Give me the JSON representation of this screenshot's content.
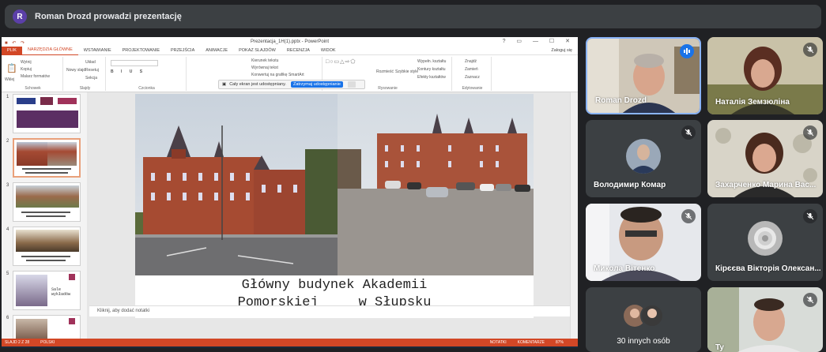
{
  "meeting": {
    "presenter_initial": "R",
    "presenter_banner": "Roman Drozd prowadzi prezentację"
  },
  "ppt": {
    "window_title": "Prezentacja_1H(1).pptx - PowerPoint",
    "tabs": [
      "PLIK",
      "NARZĘDZIA GŁÓWNE",
      "WSTAWIANIE",
      "PROJEKTOWANIE",
      "PRZEJŚCIA",
      "ANIMACJE",
      "POKAZ SLAJDÓW",
      "RECENZJA",
      "WIDOK"
    ],
    "signin": "Zaloguj się",
    "groups": {
      "clipboard": {
        "label": "Schowek",
        "items": [
          "Wklej",
          "Wytnij",
          "Kopiuj",
          "Malarz formatów"
        ]
      },
      "slides": {
        "label": "Slajdy",
        "items": [
          "Nowy slajd",
          "Układ",
          "Resetuj",
          "Sekcja"
        ]
      },
      "font": {
        "label": "Czcionka"
      },
      "paragraph": {
        "items": [
          "Kierunek tekstu",
          "Wyrównaj tekst",
          "Konwertuj na grafikę SmartArt"
        ]
      },
      "drawing": {
        "label": "Rysowanie",
        "items": [
          "Rozmieść",
          "Szybkie style",
          "Wypełn. kształtu",
          "Kontury kształtu",
          "Efekty kształtów"
        ]
      },
      "editing": {
        "label": "Edytowanie",
        "items": [
          "Znajdź",
          "Zamień",
          "Zaznacz"
        ]
      }
    },
    "share_bar": {
      "text": "Cały ekran jest udostępniany.",
      "stop": "Zatrzymaj udostępnianie"
    },
    "thumbnails": [
      {
        "num": "1"
      },
      {
        "num": "2"
      },
      {
        "num": "3"
      },
      {
        "num": "4"
      },
      {
        "num": "5",
        "caption": "Sale wykładów"
      },
      {
        "num": "6"
      }
    ],
    "slide_caption_line1": "Główny budynek Akademii",
    "slide_caption_line2": "Pomorskiej     w Słupsku",
    "notes_placeholder": "Kliknij, aby dodać notatki",
    "status": {
      "slide": "SLAJD 2 Z 28",
      "lang": "POLSKI",
      "notes": "NOTATKI",
      "comments": "KOMENTARZE",
      "zoom": "87%"
    }
  },
  "participants": [
    {
      "name": "Roman Drozd",
      "state": "speaking"
    },
    {
      "name": "Наталія Земзюліна",
      "state": "muted"
    },
    {
      "name": "Володимир Комар",
      "state": "muted"
    },
    {
      "name": "Захарченко Марина Вас...",
      "state": "muted"
    },
    {
      "name": "Микола Вітенко",
      "state": "muted"
    },
    {
      "name": "Кірєєва Вікторія Олексан...",
      "state": "muted"
    },
    {
      "name": "30 innych osób",
      "state": "group"
    },
    {
      "name": "Ty",
      "state": "muted"
    }
  ],
  "colors": {
    "accent": "#1a73e8",
    "ppt_orange": "#d24726",
    "bg": "#202124",
    "tile": "#3c4043"
  }
}
